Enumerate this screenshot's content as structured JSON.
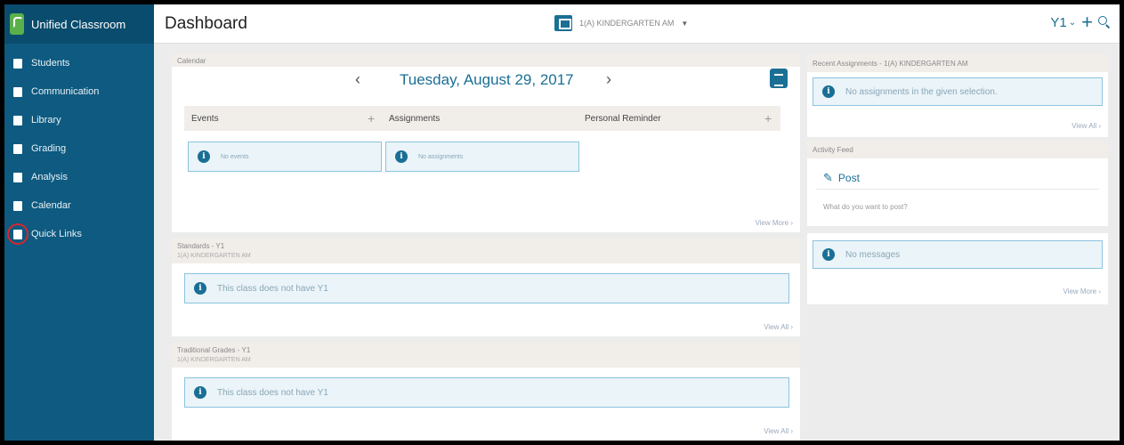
{
  "app": {
    "name": "Unified Classroom"
  },
  "sidebar": {
    "items": [
      {
        "label": "Students"
      },
      {
        "label": "Communication"
      },
      {
        "label": "Library"
      },
      {
        "label": "Grading"
      },
      {
        "label": "Analysis"
      },
      {
        "label": "Calendar"
      },
      {
        "label": "Quick Links"
      }
    ]
  },
  "header": {
    "title": "Dashboard",
    "class_name": "1(A) KINDERGARTEN AM",
    "term": "Y1",
    "term_caret": "⌄",
    "plus": "+",
    "select_caret": "▼"
  },
  "calendar": {
    "label": "Calendar",
    "date": "Tuesday, August 29, 2017",
    "prev": "‹",
    "next": "›",
    "columns": [
      "Events",
      "Assignments",
      "Personal Reminder"
    ],
    "no_events": "No events",
    "no_assignments": "No assignments",
    "view_more": "View More ›"
  },
  "standards": {
    "label": "Standards - Y1",
    "class_name": "1(A) KINDERGARTEN AM",
    "message": "This class does not have Y1",
    "view_all": "View All ›"
  },
  "traditional": {
    "label": "Traditional Grades - Y1",
    "class_name": "1(A) KINDERGARTEN AM",
    "message": "This class does not have Y1",
    "view_all": "View All ›"
  },
  "recent_assignments": {
    "label": "Recent Assignments - 1(A) KINDERGARTEN AM",
    "message": "No assignments in the given selection.",
    "view_all": "View All ›"
  },
  "activity_feed": {
    "label": "Activity Feed",
    "post_label": "Post",
    "prompt": "What do you want to post?",
    "no_messages": "No messages",
    "view_more": "View More ›"
  },
  "colors": {
    "sidebar": "#0e5a80",
    "accent": "#1a6f95",
    "highlight": "#d8262c"
  }
}
